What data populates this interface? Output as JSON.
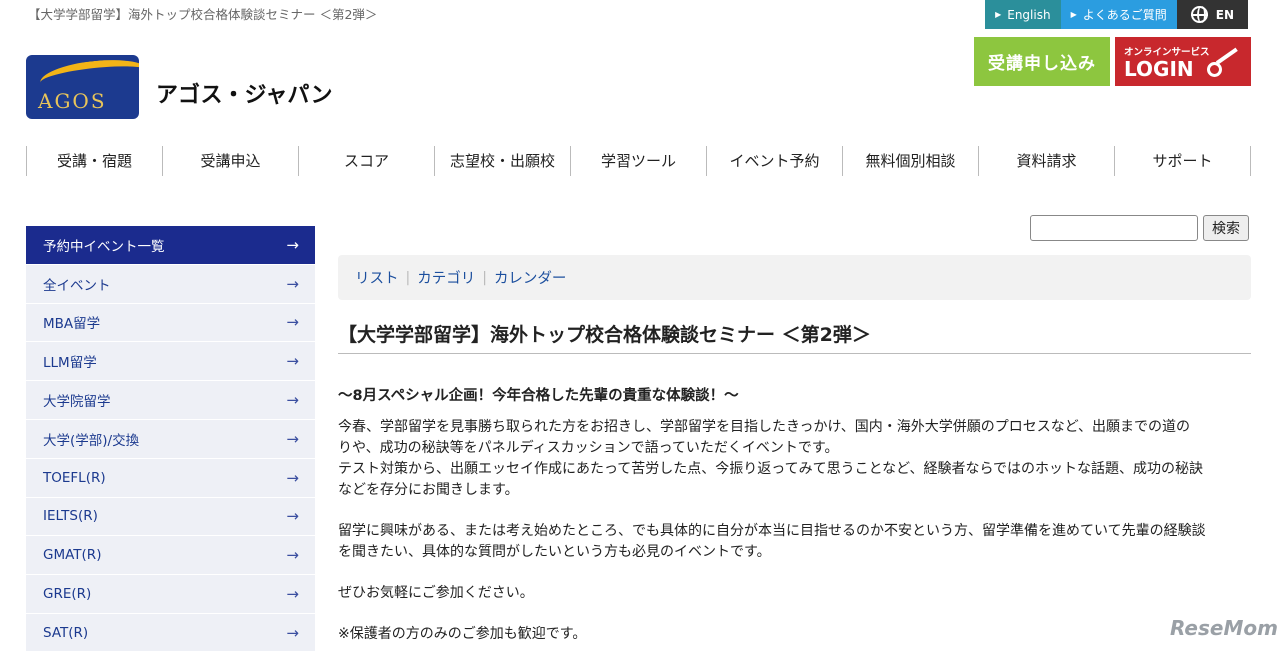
{
  "breadcrumb": "【大学学部留学】海外トップ校合格体験談セミナー ＜第2弾＞",
  "topbar": {
    "english": "English",
    "faq": "よくあるご質問",
    "en": "EN"
  },
  "buttons": {
    "apply": "受講申し込み",
    "login_sub": "オンラインサービス",
    "login_main": "LOGIN"
  },
  "logo": {
    "text": "AGOS",
    "company": "アゴス・ジャパン"
  },
  "nav": [
    "受講・宿題",
    "受講申込",
    "スコア",
    "志望校・出願校",
    "学習ツール",
    "イベント予約",
    "無料個別相談",
    "資料請求",
    "サポート"
  ],
  "sidebar": [
    {
      "label": "予約中イベント一覧",
      "active": true
    },
    {
      "label": "全イベント"
    },
    {
      "label": "MBA留学"
    },
    {
      "label": "LLM留学"
    },
    {
      "label": "大学院留学"
    },
    {
      "label": "大学(学部)/交換"
    },
    {
      "label": "TOEFL(R)"
    },
    {
      "label": "IELTS(R)"
    },
    {
      "label": "GMAT(R)"
    },
    {
      "label": "GRE(R)"
    },
    {
      "label": "SAT(R)"
    }
  ],
  "search": {
    "value": "",
    "button": "検索"
  },
  "view_tabs": [
    "リスト",
    "カテゴリ",
    "カレンダー"
  ],
  "title": "【大学学部留学】海外トップ校合格体験談セミナー ＜第2弾＞",
  "content": {
    "subheading": "〜8月スペシャル企画！今年合格した先輩の貴重な体験談！〜",
    "p1_l1": "今春、学部留学を見事勝ち取られた方をお招きし、学部留学を目指したきっかけ、国内・海外大学併願のプロセスなど、出願までの道の",
    "p1_l2": "りや、成功の秘訣等をパネルディスカッションで語っていただくイベントです。",
    "p1_l3": "テスト対策から、出願エッセイ作成にあたって苦労した点、今振り返ってみて思うことなど、経験者ならではのホットな話題、成功の秘訣",
    "p1_l4": "などを存分にお聞きします。",
    "p2_l1": "留学に興味がある、または考え始めたところ、でも具体的に自分が本当に目指せるのか不安という方、留学準備を進めていて先輩の経験談",
    "p2_l2": "を聞きたい、具体的な質問がしたいという方も必見のイベントです。",
    "p3": "ぜひお気軽にご参加ください。",
    "p4": "※保護者の方のみのご参加も歓迎です。"
  },
  "watermark": "ReseMom"
}
